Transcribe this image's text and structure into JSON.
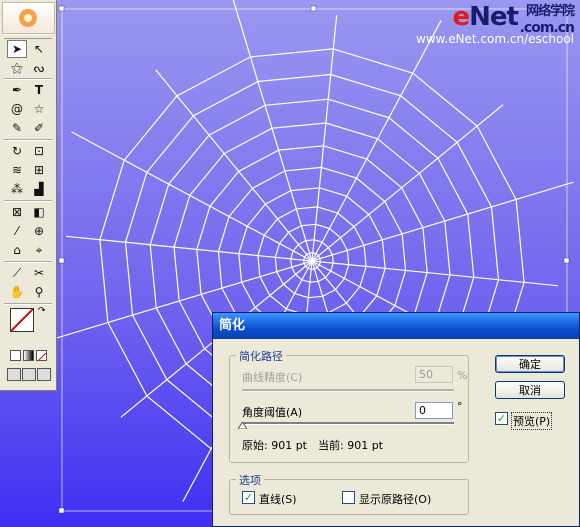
{
  "watermark": {
    "brand_e": "e",
    "brand_net": "Net",
    "brand_cn": "网络学院",
    "brand_com": ".com.cn",
    "url": "www.eNet.com.cn/eschool"
  },
  "colors": {
    "canvas_top": "#8a86f0",
    "canvas_bottom": "#3d2ff0",
    "web_line": "#ffffff",
    "dialog_bg": "#ece9d8",
    "title_bar": "#0a4fd0"
  },
  "toolbox": {
    "tools": [
      "selection-tool",
      "direct-selection-tool",
      "magic-wand-tool",
      "lasso-tool",
      "pen-tool",
      "type-tool",
      "spiral-tool",
      "star-tool",
      "paintbrush-tool",
      "pencil-tool",
      "rotate-tool",
      "scale-tool",
      "warp-tool",
      "free-transform-tool",
      "symbol-sprayer-tool",
      "column-graph-tool",
      "mesh-tool",
      "gradient-tool",
      "eyedropper-tool",
      "measure-tool",
      "live-paint-tool",
      "live-paint-select-tool",
      "slice-tool",
      "scissors-tool",
      "hand-tool",
      "zoom-tool"
    ]
  },
  "dialog": {
    "title": "简化",
    "group_path": {
      "label": "简化路径",
      "curve_precision_label": "曲线精度(C)",
      "curve_precision_value": "50",
      "curve_precision_unit": "%",
      "angle_threshold_label": "角度阈值(A)",
      "angle_threshold_value": "0",
      "angle_unit": "°",
      "original_label": "原始: 901 pt",
      "current_label": "当前: 901 pt"
    },
    "group_options": {
      "label": "选项",
      "straight_lines_label": "直线(S)",
      "straight_lines_checked": true,
      "show_original_label": "显示原路径(O)",
      "show_original_checked": false
    },
    "ok_label": "确定",
    "cancel_label": "取消",
    "preview_label": "预览(P)",
    "preview_checked": true
  }
}
